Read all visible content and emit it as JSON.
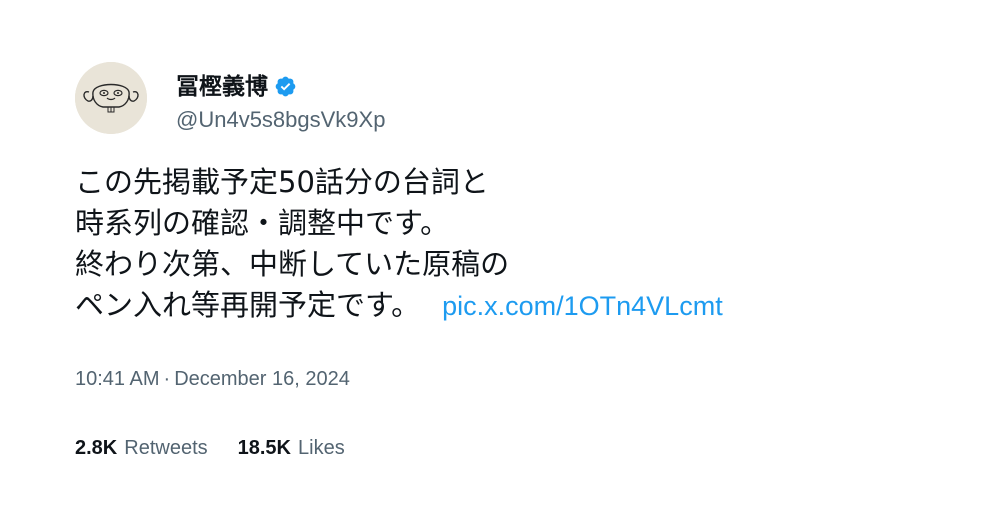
{
  "author": {
    "display_name": "冨樫義博",
    "handle": "@Un4v5s8bgsVk9Xp",
    "verified_icon": "verified-badge-icon",
    "verified_color": "#1d9bf0",
    "avatar_icon": "dog-sketch-avatar"
  },
  "tweet": {
    "lines": [
      "この先掲載予定50話分の台詞と",
      "時系列の確認・調整中です。",
      "終わり次第、中断していた原稿の",
      "ペン入れ等再開予定です。"
    ],
    "media_link": "pic.x.com/1OTn4VLcmt"
  },
  "meta": {
    "time": "10:41 AM",
    "separator": "·",
    "date": "December 16, 2024"
  },
  "stats": {
    "retweets_count": "2.8K",
    "retweets_label": "Retweets",
    "likes_count": "18.5K",
    "likes_label": "Likes"
  },
  "colors": {
    "text": "#0f1419",
    "secondary": "#536471",
    "link": "#1d9bf0"
  }
}
